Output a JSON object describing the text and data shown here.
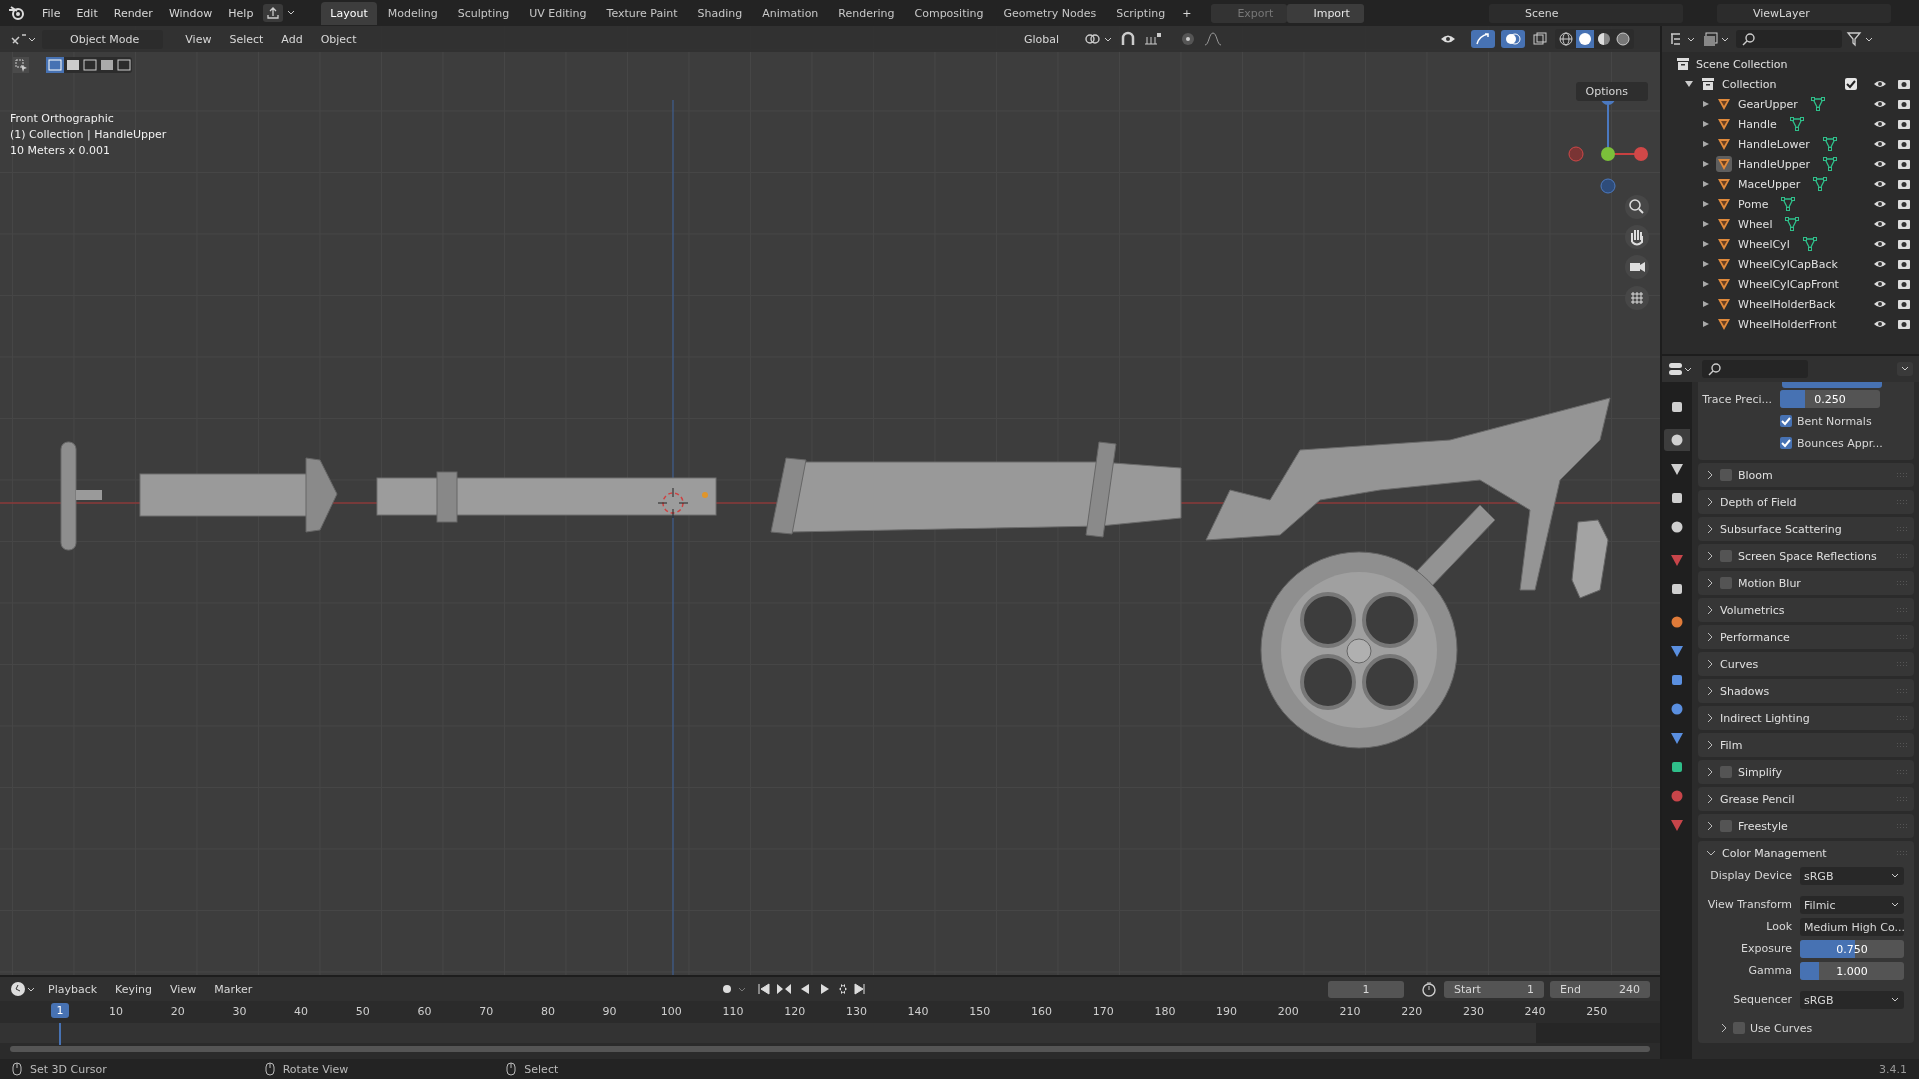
{
  "menu": [
    "File",
    "Edit",
    "Render",
    "Window",
    "Help"
  ],
  "workspaces": [
    {
      "label": "Layout",
      "selected": true
    },
    {
      "label": "Modeling",
      "selected": false
    },
    {
      "label": "Sculpting",
      "selected": false
    },
    {
      "label": "UV Editing",
      "selected": false
    },
    {
      "label": "Texture Paint",
      "selected": false
    },
    {
      "label": "Shading",
      "selected": false
    },
    {
      "label": "Animation",
      "selected": false
    },
    {
      "label": "Rendering",
      "selected": false
    },
    {
      "label": "Compositing",
      "selected": false
    },
    {
      "label": "Geometry Nodes",
      "selected": false
    },
    {
      "label": "Scripting",
      "selected": false
    }
  ],
  "add_workspace": "+",
  "transfer": [
    {
      "label": "Export",
      "disabled": true
    },
    {
      "label": "Import",
      "disabled": false
    }
  ],
  "scene": "Scene",
  "view_layer": "ViewLayer",
  "viewport_header": {
    "mode": "Object Mode",
    "menus": [
      "View",
      "Select",
      "Add",
      "Object"
    ],
    "orientation": "Global",
    "options": "Options"
  },
  "viewport_info": [
    "Front Orthographic",
    "(1) Collection | HandleUpper",
    "10 Meters x 0.001"
  ],
  "outliner": {
    "root": "Scene Collection",
    "collection": {
      "name": "Collection",
      "expanded": true,
      "checked": true,
      "children": [
        {
          "name": "GearUpper",
          "selected": false
        },
        {
          "name": "Handle",
          "selected": false
        },
        {
          "name": "HandleLower",
          "selected": false
        },
        {
          "name": "HandleUpper",
          "selected": true
        },
        {
          "name": "MaceUpper",
          "selected": false
        },
        {
          "name": "Pome",
          "selected": false
        },
        {
          "name": "Wheel",
          "selected": false
        },
        {
          "name": "WheelCyl",
          "selected": false
        },
        {
          "name": "WheelCylCapBack",
          "selected": false
        },
        {
          "name": "WheelCylCapFront",
          "selected": false
        },
        {
          "name": "WheelHolderBack",
          "selected": false
        },
        {
          "name": "WheelHolderFront",
          "selected": false
        }
      ]
    }
  },
  "property_tabs": [
    {
      "selected": false
    },
    {
      "selected": true
    },
    {
      "selected": false
    },
    {
      "selected": false
    },
    {
      "selected": false
    },
    {
      "selected": false
    },
    {
      "selected": false
    },
    {
      "selected": false
    },
    {
      "selected": false
    },
    {
      "selected": false
    },
    {
      "selected": false
    },
    {
      "selected": false
    },
    {
      "selected": false
    },
    {
      "selected": false
    },
    {
      "selected": false
    }
  ],
  "trace_precision": {
    "label": "Trace Preci...",
    "value": "0.250",
    "level": 0.25
  },
  "options": [
    {
      "label": "Bent Normals",
      "checked": true
    },
    {
      "label": "Bounces Appr...",
      "checked": true
    }
  ],
  "panels": [
    {
      "label": "Bloom",
      "kind": "toggle",
      "checked": false
    },
    {
      "label": "Depth of Field",
      "kind": "plain"
    },
    {
      "label": "Subsurface Scattering",
      "kind": "plain"
    },
    {
      "label": "Screen Space Reflections",
      "kind": "toggle",
      "checked": false
    },
    {
      "label": "Motion Blur",
      "kind": "toggle",
      "checked": false
    },
    {
      "label": "Volumetrics",
      "kind": "plain"
    },
    {
      "label": "Performance",
      "kind": "plain"
    },
    {
      "label": "Curves",
      "kind": "plain"
    },
    {
      "label": "Shadows",
      "kind": "plain"
    },
    {
      "label": "Indirect Lighting",
      "kind": "plain"
    },
    {
      "label": "Film",
      "kind": "plain"
    },
    {
      "label": "Simplify",
      "kind": "toggle",
      "checked": false
    },
    {
      "label": "Grease Pencil",
      "kind": "plain"
    },
    {
      "label": "Freestyle",
      "kind": "toggle",
      "checked": false
    }
  ],
  "color_management": {
    "label": "Color Management",
    "expanded": true,
    "fields": [
      {
        "kind": "dropdown",
        "label": "Display Device",
        "value": "sRGB"
      },
      {
        "kind": "dropdown",
        "label": "View Transform",
        "value": "Filmic"
      },
      {
        "kind": "dropdown",
        "label": "Look",
        "value": "Medium High Co..."
      },
      {
        "kind": "slider",
        "label": "Exposure",
        "value": "0.750",
        "level": 0.53
      },
      {
        "kind": "slider",
        "label": "Gamma",
        "value": "1.000",
        "level": 0.18
      },
      {
        "kind": "dropdown",
        "label": "Sequencer",
        "value": "sRGB"
      }
    ],
    "use_curves": {
      "label": "Use Curves",
      "checked": false
    }
  },
  "timeline": {
    "menus": [
      "Playback",
      "Keying",
      "View",
      "Marker"
    ],
    "current_frame": "1",
    "start_label": "Start",
    "start": "1",
    "end_label": "End",
    "end": "240",
    "marker": "1",
    "ticks": [
      "10",
      "20",
      "30",
      "40",
      "50",
      "60",
      "70",
      "80",
      "90",
      "100",
      "110",
      "120",
      "130",
      "140",
      "150",
      "160",
      "170",
      "180",
      "190",
      "200",
      "210",
      "220",
      "230",
      "240",
      "250"
    ]
  },
  "status_bar": {
    "hints": [
      "Set 3D Cursor",
      "Rotate View",
      "Select"
    ],
    "version": "3.4.1"
  }
}
